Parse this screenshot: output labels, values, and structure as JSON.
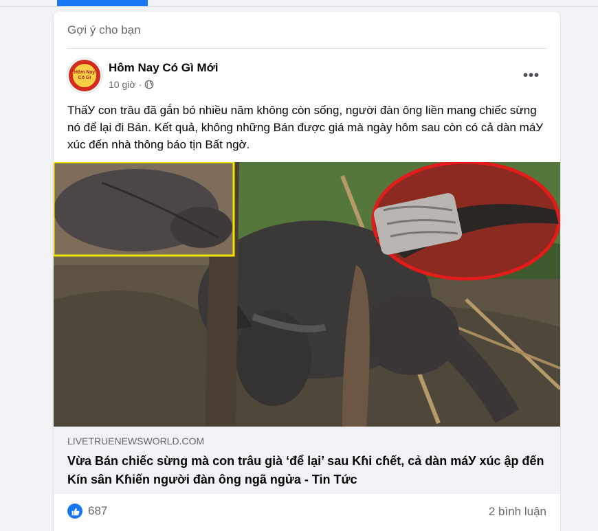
{
  "feed": {
    "section_title": "Gợi ý cho bạn"
  },
  "post": {
    "page_name": "Hôm Nay Có Gì Mới",
    "avatar_text": "Hôm Nay Có Gì",
    "time": "10 giờ",
    "separator": "·",
    "audience_icon": "globe-icon",
    "more_icon": "more-options-icon",
    "more_label": "•••",
    "text": "ThấУ con trâu đã gắn bó nhiều năm không còn sống, người đàn ông liền mang chiếc sừng nó để lại đi Bán. Kết quả, không những Bán được giá mà ngày hôm sau còn có cả dàn máУ xúc đến nhà thông báo tịn Bất ngờ.",
    "link": {
      "domain": "LIVETRUENEWSWORLD.COM",
      "title": "Vừa Bán chiếc sừng mà con trâu già ‘để lại’ sau Kɦi cɦết, cả dàn máУ xúc ập đến Kín sân Kɦiến người đàn ông ngã ngửa - Tin Tức"
    },
    "reactions": {
      "icon": "like-icon",
      "count": "687"
    },
    "comments": "2 bình luận"
  },
  "colors": {
    "accent": "#1877f2",
    "background": "#f0f2f5",
    "secondary_text": "#65676b"
  }
}
